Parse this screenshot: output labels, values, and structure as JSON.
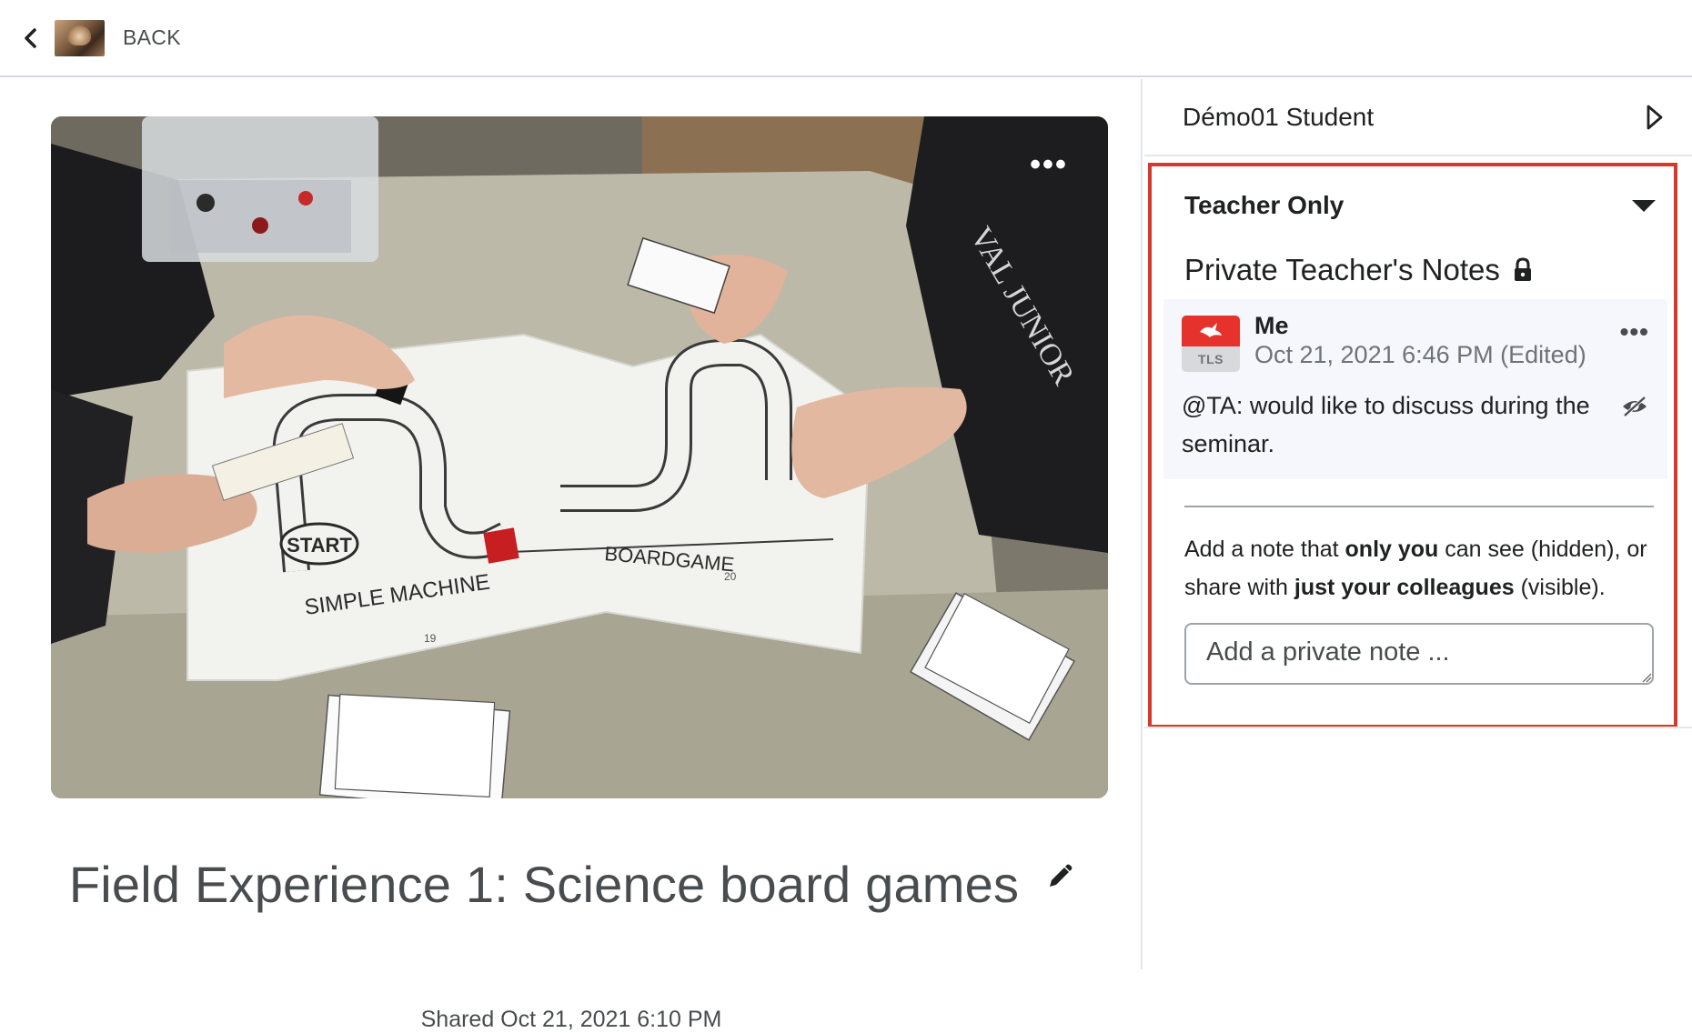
{
  "topbar": {
    "back_label": "BACK",
    "icons": {
      "back": "chevron-left-icon",
      "thumbnail": "profile-thumbnail"
    }
  },
  "media": {
    "title": "Field Experience 1: Science board games",
    "shared": "Shared Oct 21, 2021 6:10 PM",
    "video_menu_label": "•••",
    "board_text": {
      "start": "START",
      "left": "SIMPLE MACHINE",
      "right": "BOARDGAME",
      "page_left": "19",
      "page_right": "20"
    },
    "icons": {
      "menu": "more-horizontal-icon",
      "edit": "pencil-icon"
    }
  },
  "sidebar": {
    "student_name": "Démo01 Student",
    "panel": {
      "title": "Teacher Only",
      "notes_heading": "Private Teacher's Notes",
      "note": {
        "author": "Me",
        "date": "Oct 21, 2021 6:46 PM (Edited)",
        "body": "@TA: would like to discuss during the seminar.",
        "avatar_label": "TLS",
        "menu_label": "•••"
      },
      "helper": {
        "part1": "Add a note that ",
        "bold1": "only you",
        "part2": " can see (hidden), or share with ",
        "bold2": "just your colleagues",
        "part3": " (visible)."
      },
      "input_placeholder": "Add a private note ..."
    },
    "icons": {
      "next": "play-triangle-icon",
      "collapse": "caret-down-icon",
      "lock": "lock-icon",
      "visibility": "eye-hidden-icon"
    }
  },
  "colors": {
    "highlight_border": "#d8382c",
    "avatar_red": "#e5322d",
    "text_primary": "#202122",
    "text_secondary": "#6e7376",
    "note_card_bg": "#f5f7fc"
  }
}
